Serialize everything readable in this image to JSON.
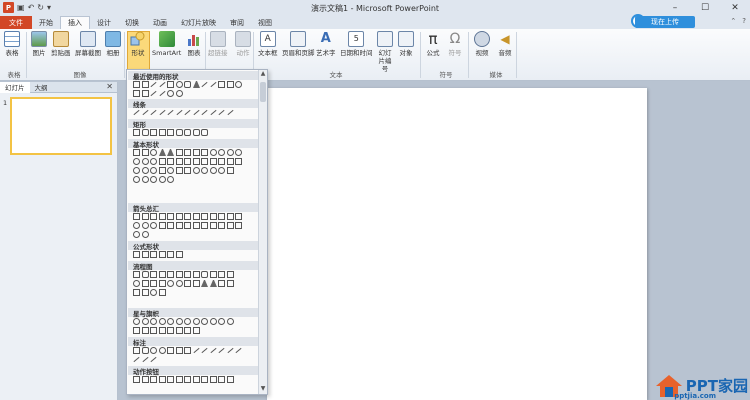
{
  "window": {
    "title": "演示文稿1 - Microsoft PowerPoint",
    "app_letter": "P"
  },
  "tabs": [
    {
      "label": "文件"
    },
    {
      "label": "开始"
    },
    {
      "label": "插入"
    },
    {
      "label": "设计"
    },
    {
      "label": "切换"
    },
    {
      "label": "动画"
    },
    {
      "label": "幻灯片放映"
    },
    {
      "label": "审阅"
    },
    {
      "label": "视图"
    }
  ],
  "login": {
    "label": "现在上传"
  },
  "ribbon": {
    "buttons": [
      {
        "label": "表格"
      },
      {
        "label": "图片"
      },
      {
        "label": "剪贴画"
      },
      {
        "label": "屏幕截图"
      },
      {
        "label": "相册"
      },
      {
        "label": "形状"
      },
      {
        "label": "SmartArt"
      },
      {
        "label": "图表"
      },
      {
        "label": "超链接"
      },
      {
        "label": "动作"
      },
      {
        "label": "文本框"
      },
      {
        "label": "页眉和页脚"
      },
      {
        "label": "艺术字"
      },
      {
        "label": "日期和时间"
      },
      {
        "label": "幻灯片编号"
      },
      {
        "label": "对象"
      },
      {
        "label": "公式"
      },
      {
        "label": "符号"
      },
      {
        "label": "视频"
      },
      {
        "label": "音频"
      }
    ],
    "groups": [
      {
        "label": "表格"
      },
      {
        "label": "图像"
      },
      {
        "label": "文本"
      },
      {
        "label": "符号"
      },
      {
        "label": "媒体"
      }
    ]
  },
  "left_panel": {
    "tab_slides": "幻灯片",
    "tab_outline": "大纲",
    "slide_number": "1"
  },
  "shapes_menu": {
    "sections": [
      {
        "title": "最近使用的形状"
      },
      {
        "title": "线条"
      },
      {
        "title": "矩形"
      },
      {
        "title": "基本形状"
      },
      {
        "title": "箭头总汇"
      },
      {
        "title": "公式形状"
      },
      {
        "title": "流程图"
      },
      {
        "title": "星与旗帜"
      },
      {
        "title": "标注"
      },
      {
        "title": "动作按钮"
      }
    ]
  },
  "watermark": {
    "brand": "PPT家园",
    "domain": "pptjia.com"
  },
  "colors": {
    "file_tab": "#d24726",
    "accent": "#2f8fdc",
    "shape_btn_active": "#fbd97a",
    "brand_blue": "#1a66b2"
  }
}
